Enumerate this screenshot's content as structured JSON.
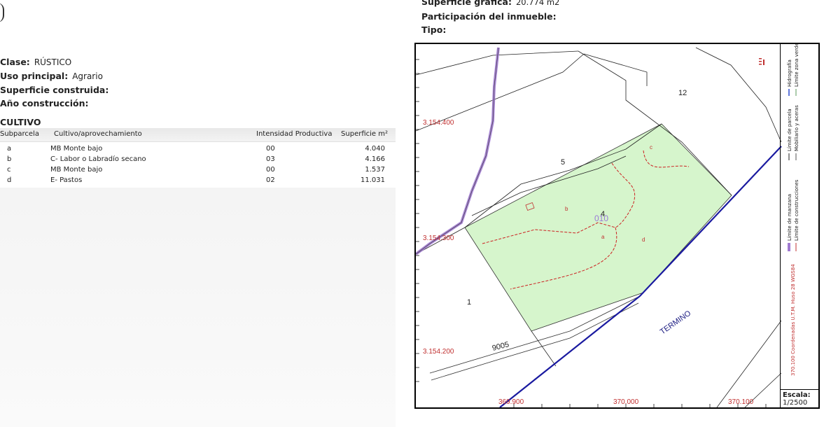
{
  "left": {
    "clase_label": "Clase:",
    "clase_value": "RÚSTICO",
    "uso_label": "Uso principal:",
    "uso_value": "Agrario",
    "sup_construida_label": "Superficie construida:",
    "anio_label": "Año construcción:",
    "section_title": "CULTIVO"
  },
  "table": {
    "headers": [
      "Subparcela",
      "Cultivo/aprovechamiento",
      "Intensidad Productiva",
      "Superficie m²"
    ],
    "rows": [
      {
        "sub": "a",
        "cultivo": "MB Monte bajo",
        "intensidad": "00",
        "superficie": "4.040"
      },
      {
        "sub": "b",
        "cultivo": "C- Labor o Labradío secano",
        "intensidad": "03",
        "superficie": "4.166"
      },
      {
        "sub": "c",
        "cultivo": "MB Monte bajo",
        "intensidad": "00",
        "superficie": "1.537"
      },
      {
        "sub": "d",
        "cultivo": "E- Pastos",
        "intensidad": "02",
        "superficie": "11.031"
      }
    ]
  },
  "top_right": {
    "sup_grafica_label": "Superficie gráfica:",
    "sup_grafica_value": "20.774 m2",
    "participacion_label": "Participación del inmueble:",
    "tipo_label": "Tipo:"
  },
  "map": {
    "y_labels": [
      "3.154.400",
      "3.154.300",
      "3.154.200"
    ],
    "x_labels": [
      "369.900",
      "370.000",
      "370.100"
    ],
    "parcel_numbers": [
      "12",
      "5",
      "4",
      "1"
    ],
    "subparcel_letters": [
      "c",
      "b",
      "a",
      "d"
    ],
    "parcel_code": "010",
    "termino_label": "TERMINO",
    "road_label": "9005",
    "colors": {
      "parcel_fill": "#d6f5cc",
      "subparcel_line": "#cc2222",
      "boundary_line": "#1a1aa0",
      "road_line": "#a07ad0",
      "coord_text": "#c03030"
    }
  },
  "legend": {
    "manzana": "Límite de manzana",
    "parcela": "Límite de parcela",
    "hidrografia": "Hidrografía",
    "construcciones": "Límite de construcciones",
    "mobiliario": "Mobiliario y aceras",
    "zona_verde": "Límite zona verde",
    "coords_note": "370.100 Coordenadas U.T.M. Huso 28 WGS84"
  },
  "scale": {
    "label": "Escala:",
    "value": "1/2500"
  }
}
